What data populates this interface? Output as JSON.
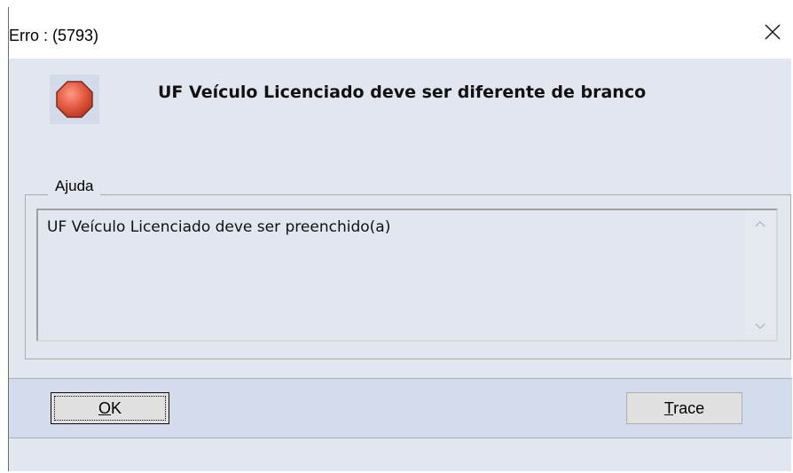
{
  "window": {
    "title": "Erro : (5793)"
  },
  "dialog": {
    "icon": "stop-icon",
    "message": "UF Veículo Licenciado deve ser diferente de branco",
    "help": {
      "legend": "Ajuda",
      "text": "UF Veículo Licenciado deve ser preenchido(a)"
    }
  },
  "buttons": {
    "ok_label": "OK",
    "trace_label": "Trace"
  },
  "colors": {
    "dialog_bg": "#e1e6ef",
    "button_bar_bg": "#d3dcec",
    "stop_red": "#e0523b"
  }
}
